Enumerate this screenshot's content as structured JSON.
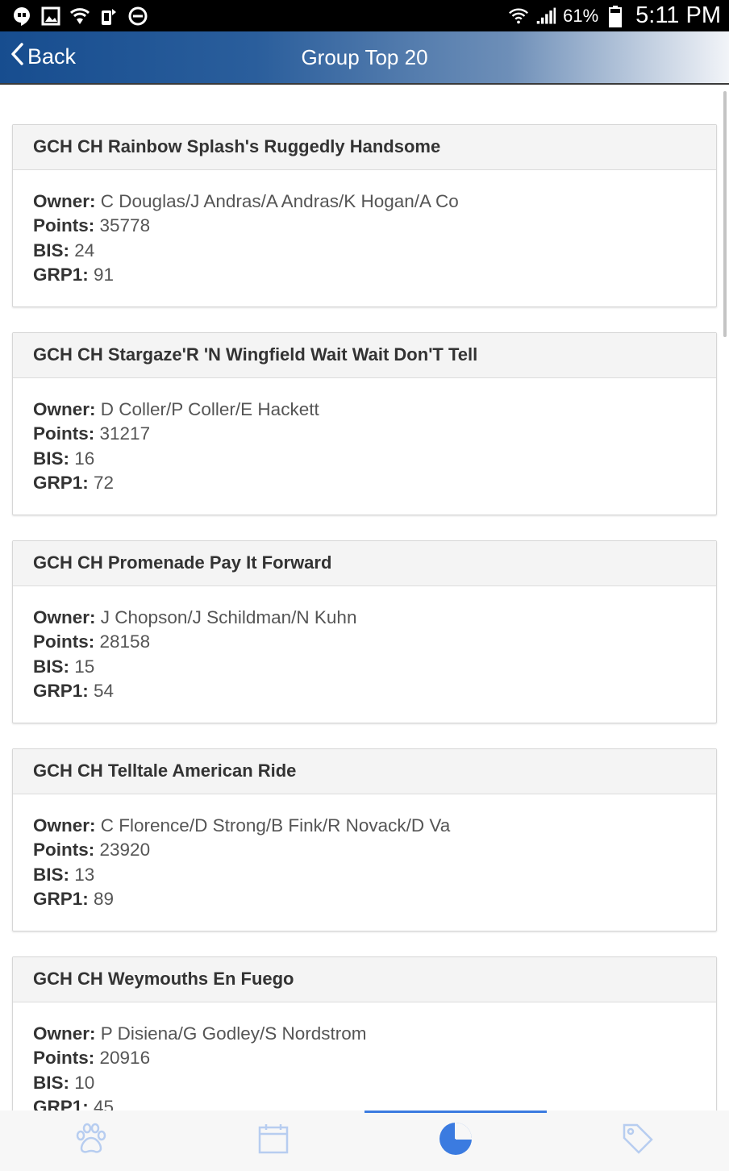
{
  "status_bar": {
    "battery_percent": "61%",
    "time": "5:11 PM",
    "icons": [
      "hangouts-icon",
      "gallery-icon",
      "wifi-lock-icon",
      "tmobile-icon",
      "do-not-disturb-icon",
      "wifi-icon",
      "signal-icon",
      "battery-icon"
    ]
  },
  "header": {
    "back_label": "Back",
    "title": "Group Top 20",
    "colors": {
      "start": "#174d8f",
      "end": "#f2f4f8"
    }
  },
  "labels": {
    "owner": "Owner:",
    "points": "Points:",
    "bis": "BIS:",
    "grp1": "GRP1:"
  },
  "cards": [
    {
      "name": "GCH CH Rainbow Splash's Ruggedly Handsome",
      "owner": "C Douglas/J Andras/A Andras/K Hogan/A Co",
      "points": "35778",
      "bis": "24",
      "grp1": "91"
    },
    {
      "name": "GCH CH Stargaze'R 'N Wingfield Wait Wait Don'T Tell",
      "owner": "D Coller/P Coller/E Hackett",
      "points": "31217",
      "bis": "16",
      "grp1": "72"
    },
    {
      "name": "GCH CH Promenade Pay It Forward",
      "owner": "J Chopson/J Schildman/N Kuhn",
      "points": "28158",
      "bis": "15",
      "grp1": "54"
    },
    {
      "name": "GCH CH Telltale American Ride",
      "owner": "C Florence/D Strong/B Fink/R Novack/D Va",
      "points": "23920",
      "bis": "13",
      "grp1": "89"
    },
    {
      "name": "GCH CH Weymouths En Fuego",
      "owner": "P Disiena/G Godley/S Nordstrom",
      "points": "20916",
      "bis": "10",
      "grp1": "45"
    }
  ],
  "bottom_nav": {
    "items": [
      {
        "icon": "paw-icon",
        "active": false
      },
      {
        "icon": "calendar-icon",
        "active": false
      },
      {
        "icon": "pie-chart-icon",
        "active": true
      },
      {
        "icon": "tag-icon",
        "active": false
      }
    ],
    "active_color": "#3b7be0",
    "inactive_color": "#b7cdf0"
  }
}
